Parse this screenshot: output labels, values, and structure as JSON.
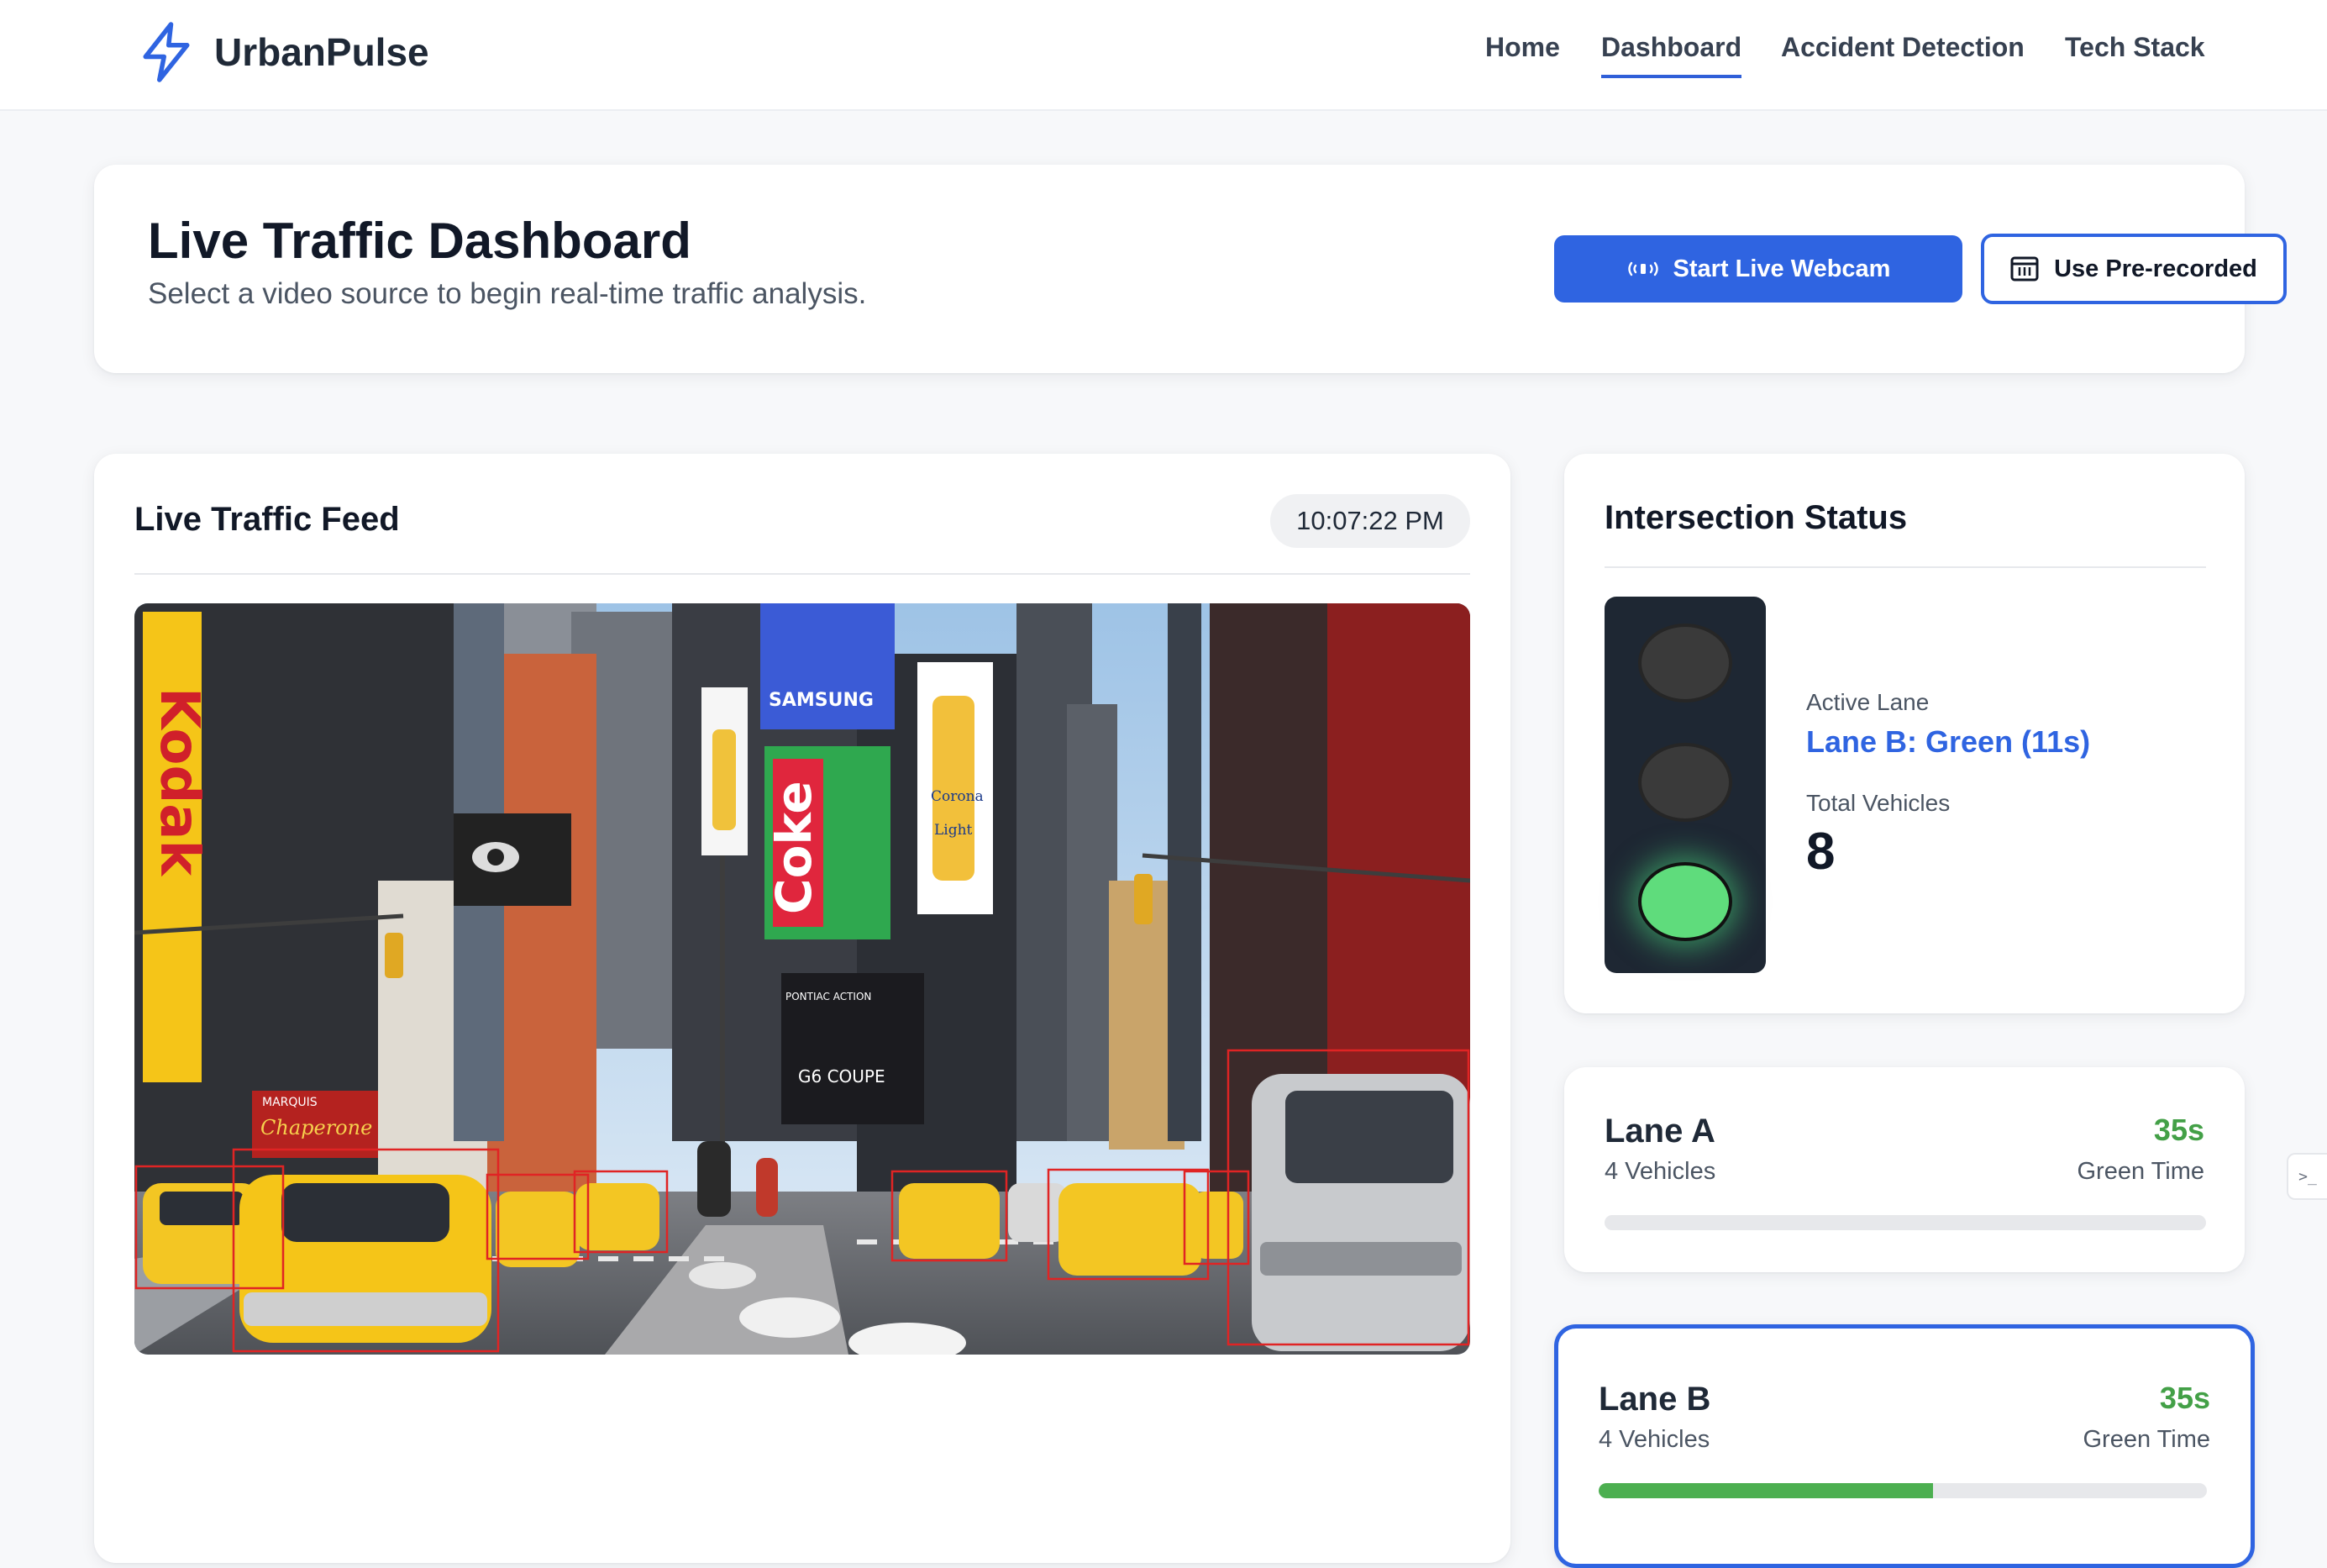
{
  "app": {
    "brand_name": "UrbanPulse",
    "brand_icon": "lightning-bolt-icon",
    "accent_color": "#2f64e1"
  },
  "nav": {
    "links": [
      {
        "label": "Home",
        "active": false
      },
      {
        "label": "Dashboard",
        "active": true
      },
      {
        "label": "Accident Detection",
        "active": false
      },
      {
        "label": "Tech Stack",
        "active": false
      }
    ]
  },
  "header": {
    "title": "Live Traffic Dashboard",
    "subtitle": "Select a video source to begin real-time traffic analysis.",
    "webcam_button": {
      "label": "Start Live Webcam",
      "icon": "broadcast-icon"
    },
    "prerecorded_button": {
      "label": "Use Pre-recorded",
      "icon": "video-file-icon"
    }
  },
  "feed": {
    "title": "Live Traffic Feed",
    "timestamp": "10:07:22 PM",
    "scene_signs": {
      "kodak": "Kodak",
      "samsung": "SAMSUNG",
      "coke": "Coke",
      "corona": "Corona",
      "corona_light": "Light",
      "chaperone": "Chaperone",
      "marquis": "MARQUIS",
      "g6_coupe": "G6 COUPE",
      "pontiac": "PONTIAC ACTION"
    }
  },
  "intersection": {
    "title": "Intersection Status",
    "active_lane_label": "Active Lane",
    "active_lane_value": "Lane B: Green (11s)",
    "total_vehicles_label": "Total Vehicles",
    "total_vehicles_value": "8",
    "signal_state": "green"
  },
  "lanes": [
    {
      "name": "Lane A",
      "vehicles": "4 Vehicles",
      "time": "35s",
      "time_label": "Green Time",
      "progress": 0,
      "active": false
    },
    {
      "name": "Lane B",
      "vehicles": "4 Vehicles",
      "time": "35s",
      "time_label": "Green Time",
      "progress": 0.55,
      "active": true
    }
  ],
  "side_tab": {
    "glyph": ">_"
  }
}
